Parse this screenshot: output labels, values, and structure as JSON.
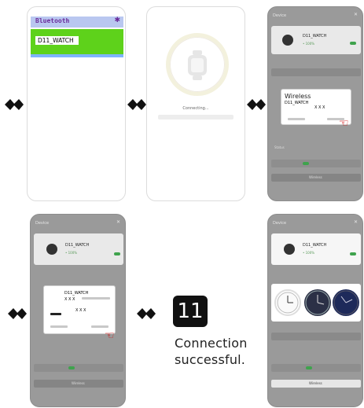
{
  "step1": {
    "header_title": "Bluetooth",
    "device_label": "D11_WATCH"
  },
  "step2": {
    "status_text": "Connecting..."
  },
  "step3": {
    "header_title": "Device",
    "device_name": "D11_WATCH",
    "device_sub": "• 100%",
    "dialog_title": "Wireless",
    "dialog_id": "D11_WATCH",
    "dialog_code": "X X X",
    "section_label": "Status",
    "row_label": "Wireless"
  },
  "step4": {
    "header_title": "Device",
    "device_name": "D11_WATCH",
    "device_sub": "• 100%",
    "dialog_id": "D11_WATCH",
    "dialog_code": "X X X",
    "row_label": "Wireless"
  },
  "step5": {
    "header_title": "Device",
    "device_name": "D11_WATCH",
    "device_sub": "• 100%",
    "row_label": "Wireless"
  },
  "step_number": "11",
  "description_line1": "Connection",
  "description_line2": "successful.",
  "icons": [
    "arrow-right-icon",
    "watch-icon",
    "hand-pointer-icon"
  ],
  "colors": {
    "accent_green": "#5ed21b",
    "header_blue": "#b9c7f0",
    "hand_red": "#d00000",
    "dark_panel": "#9a9a9a"
  }
}
